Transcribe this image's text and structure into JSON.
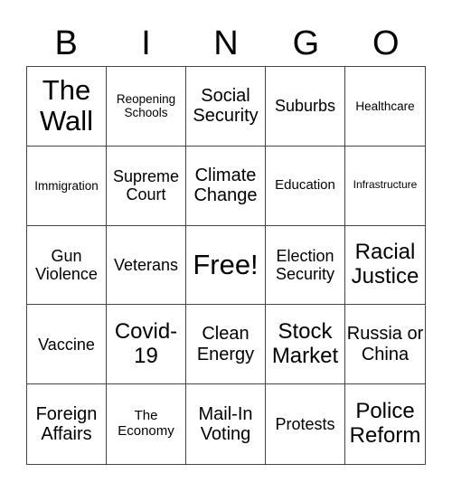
{
  "header": {
    "letters": [
      "B",
      "I",
      "N",
      "G",
      "O"
    ]
  },
  "cells": [
    {
      "text": "The Wall",
      "size": "s-xl"
    },
    {
      "text": "Reopening Schools",
      "size": "s-xxs"
    },
    {
      "text": "Social Security",
      "size": "s-m"
    },
    {
      "text": "Suburbs",
      "size": "s-s"
    },
    {
      "text": "Healthcare",
      "size": "s-xxs"
    },
    {
      "text": "Immigration",
      "size": "s-xxs"
    },
    {
      "text": "Supreme Court",
      "size": "s-s"
    },
    {
      "text": "Climate Change",
      "size": "s-m"
    },
    {
      "text": "Education",
      "size": "s-xs"
    },
    {
      "text": "Infrastructure",
      "size": "s-tiny"
    },
    {
      "text": "Gun Violence",
      "size": "s-s"
    },
    {
      "text": "Veterans",
      "size": "s-s"
    },
    {
      "text": "Free!",
      "size": "s-xl"
    },
    {
      "text": "Election Security",
      "size": "s-s"
    },
    {
      "text": "Racial Justice",
      "size": "s-l"
    },
    {
      "text": "Vaccine",
      "size": "s-s"
    },
    {
      "text": "Covid-19",
      "size": "s-l"
    },
    {
      "text": "Clean Energy",
      "size": "s-m"
    },
    {
      "text": "Stock Market",
      "size": "s-l"
    },
    {
      "text": "Russia or China",
      "size": "s-m"
    },
    {
      "text": "Foreign Affairs",
      "size": "s-m"
    },
    {
      "text": "The Economy",
      "size": "s-xs"
    },
    {
      "text": "Mail-In Voting",
      "size": "s-m"
    },
    {
      "text": "Protests",
      "size": "s-s"
    },
    {
      "text": "Police Reform",
      "size": "s-l"
    }
  ]
}
